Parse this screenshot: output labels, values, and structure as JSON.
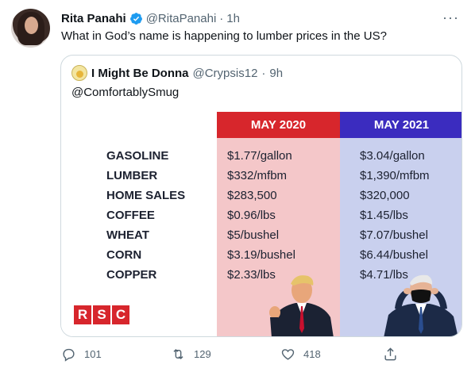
{
  "tweet": {
    "author_name": "Rita Panahi",
    "handle": "@RitaPanahi",
    "separator": "·",
    "time": "1h",
    "more": "···",
    "text": "What in God’s name is happening to lumber prices in the US?"
  },
  "quote": {
    "author_name": "I Might Be Donna",
    "handle": "@Crypsis12",
    "separator": "·",
    "time": "9h",
    "text": "@ComfortablySmug",
    "image": {
      "header_2020": "MAY 2020",
      "header_2021": "MAY 2021",
      "rows": [
        {
          "label": "GASOLINE",
          "v2020": "$1.77/gallon",
          "v2021": "$3.04/gallon"
        },
        {
          "label": "LUMBER",
          "v2020": "$332/mfbm",
          "v2021": "$1,390/mfbm"
        },
        {
          "label": "HOME SALES",
          "v2020": "$283,500",
          "v2021": "$320,000"
        },
        {
          "label": "COFFEE",
          "v2020": "$0.96/lbs",
          "v2021": "$1.45/lbs"
        },
        {
          "label": "WHEAT",
          "v2020": "$5/bushel",
          "v2021": "$7.07/bushel"
        },
        {
          "label": "CORN",
          "v2020": "$3.19/bushel",
          "v2021": "$6.44/bushel"
        },
        {
          "label": "COPPER",
          "v2020": "$2.33/lbs",
          "v2021": "$4.71/lbs"
        }
      ],
      "logo": [
        "R",
        "S",
        "C"
      ],
      "colors": {
        "red": "#d7262c",
        "blue": "#3b2cbf",
        "pink_bg": "#f4c7c9",
        "blue_bg": "#c9d0ee"
      }
    }
  },
  "actions": {
    "reply_count": "101",
    "retweet_count": "129",
    "like_count": "418",
    "icons": [
      "reply-icon",
      "retweet-icon",
      "like-icon",
      "share-icon"
    ]
  },
  "colors": {
    "verified": "#1d9bf0",
    "muted": "#536471",
    "text": "#0f1419",
    "border": "#cfd9de"
  }
}
